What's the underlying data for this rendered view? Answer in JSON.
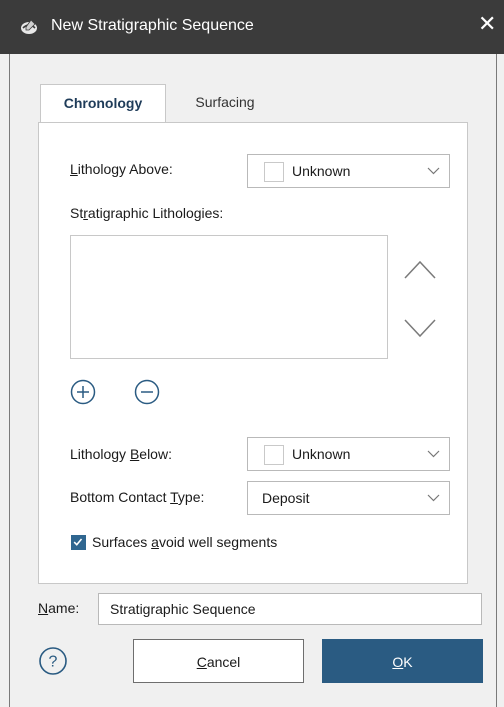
{
  "window": {
    "title": "New Stratigraphic Sequence",
    "close_glyph": "✕"
  },
  "tabs": [
    {
      "label": "Chronology",
      "active": true
    },
    {
      "label": "Surfacing",
      "active": false
    }
  ],
  "chronology": {
    "lithology_above": {
      "label_pre": "",
      "label_u": "L",
      "label_post": "ithology Above:",
      "value": "Unknown"
    },
    "strat_lithologies": {
      "label_pre": "St",
      "label_u": "r",
      "label_post": "atigraphic Lithologies:",
      "items": []
    },
    "lithology_below": {
      "label_pre": "Lithology ",
      "label_u": "B",
      "label_post": "elow:",
      "value": "Unknown"
    },
    "bottom_contact": {
      "label_pre": "Bottom Contact ",
      "label_u": "T",
      "label_post": "ype:",
      "value": "Deposit"
    },
    "avoid_wells": {
      "label_pre": "Surfaces ",
      "label_u": "a",
      "label_post": "void well segments",
      "checked": true
    }
  },
  "name": {
    "label_u": "N",
    "label_post": "ame:",
    "value": "Stratigraphic Sequence"
  },
  "buttons": {
    "cancel": {
      "label_u": "C",
      "label_post": "ancel"
    },
    "ok": {
      "label_u": "O",
      "label_post": "K"
    }
  },
  "colors": {
    "accent": "#2a5b82",
    "titlebar": "#3b3b3b",
    "checkbox": "#2f6690"
  },
  "icons": {
    "app": "app-icon",
    "close": "close-icon",
    "chevron": "chevron-down-icon",
    "up": "arrow-up-icon",
    "down": "arrow-down-icon",
    "add": "add-circle-icon",
    "remove": "remove-circle-icon",
    "help": "help-icon",
    "check": "checkmark-icon"
  }
}
